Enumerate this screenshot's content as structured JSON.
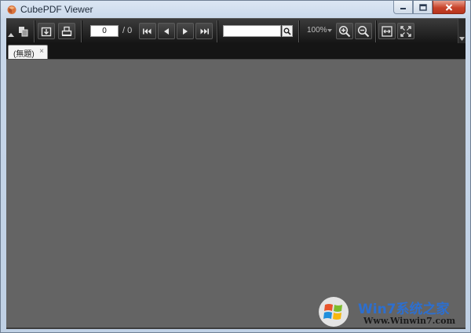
{
  "window": {
    "title": "CubePDF Viewer",
    "icons": {
      "app": "cube-app-icon",
      "minimize": "minimize-icon",
      "maximize": "maximize-icon",
      "close": "close-icon"
    }
  },
  "toolbar": {
    "page_current": "0",
    "page_total": "/ 0",
    "search_value": "",
    "zoom": "100%",
    "icons": [
      "collapse-arrow-icon",
      "thumbnail-pages-icon",
      "open-file-icon",
      "print-icon",
      "first-page-icon",
      "previous-page-icon",
      "next-page-icon",
      "last-page-icon",
      "search-icon",
      "zoom-in-icon",
      "zoom-out-icon",
      "fit-width-icon",
      "fit-page-icon"
    ]
  },
  "tabs": [
    {
      "label": "(無題)",
      "close": "×"
    }
  ],
  "watermark": {
    "brand": "Win7系统之家",
    "url": "Www.Winwin7.com"
  },
  "colors": {
    "toolbar": "#1e1e1e",
    "document_bg": "#646464",
    "title_bar": "#d6e2f0",
    "close_button": "#c8442b"
  }
}
